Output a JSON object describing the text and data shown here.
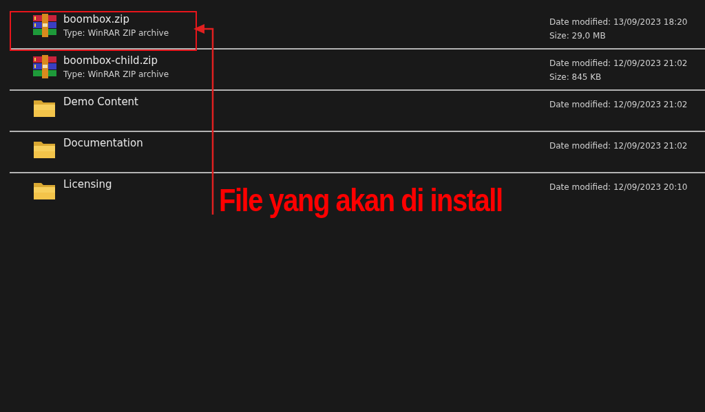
{
  "rows": [
    {
      "kind": "archive",
      "name": "boombox.zip",
      "type": "Type: WinRAR ZIP archive",
      "date": "Date modified: 13/09/2023 18:20",
      "size": "Size: 29,0 MB",
      "highlighted": true
    },
    {
      "kind": "archive",
      "name": "boombox-child.zip",
      "type": "Type: WinRAR ZIP archive",
      "date": "Date modified: 12/09/2023 21:02",
      "size": "Size: 845 KB",
      "highlighted": false
    },
    {
      "kind": "folder",
      "name": "Demo Content",
      "date": "Date modified: 12/09/2023 21:02",
      "highlighted": false
    },
    {
      "kind": "folder",
      "name": "Documentation",
      "date": "Date modified: 12/09/2023 21:02",
      "highlighted": false
    },
    {
      "kind": "folder",
      "name": "Licensing",
      "date": "Date modified: 12/09/2023 20:10",
      "highlighted": false
    }
  ],
  "annotation": {
    "text": "File yang akan di install"
  }
}
